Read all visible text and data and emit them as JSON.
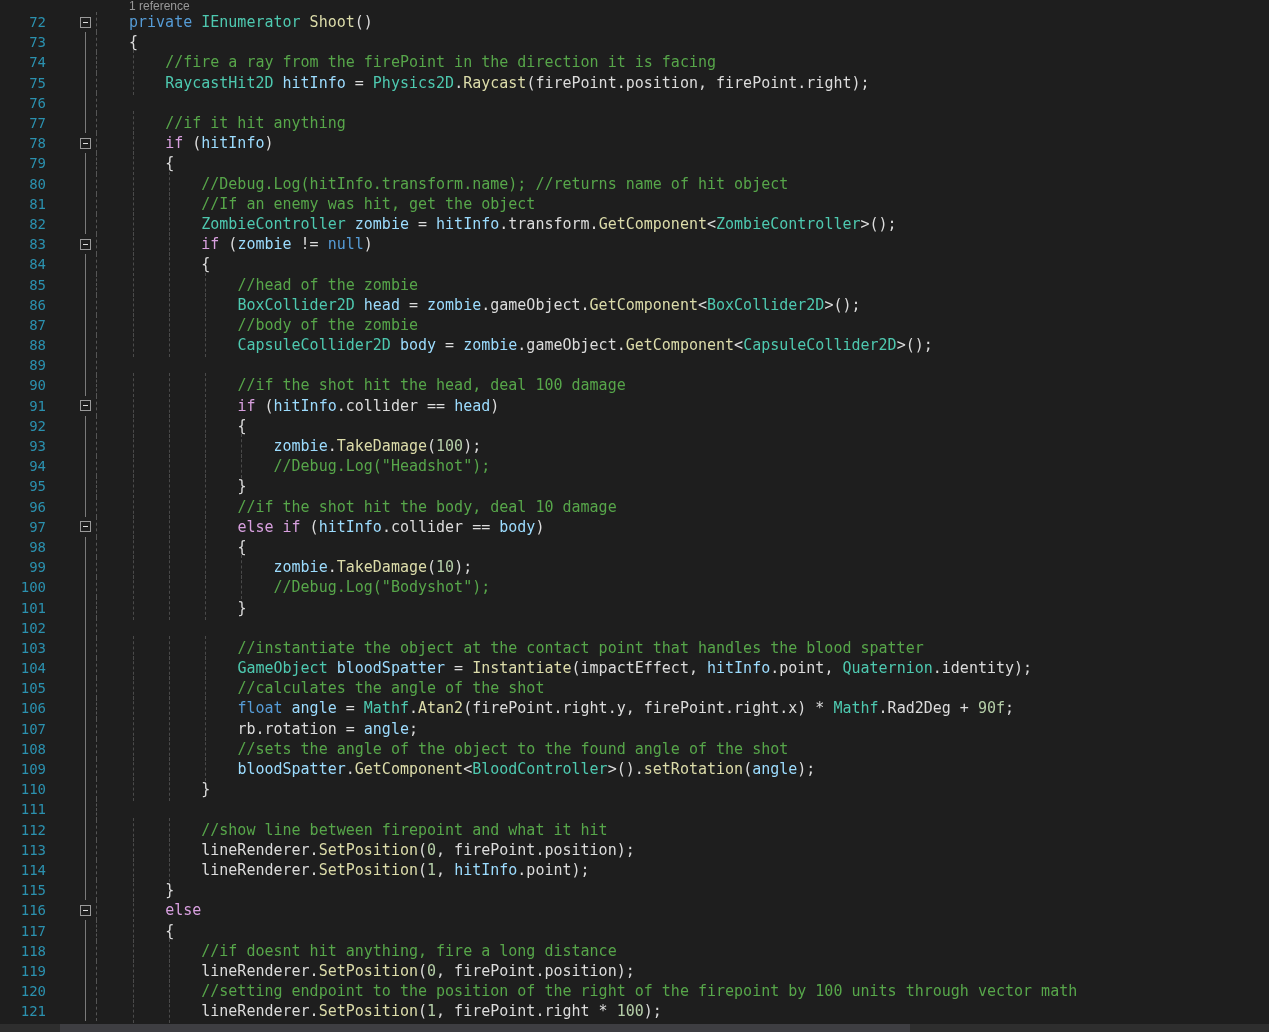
{
  "codelens": "1 reference",
  "lines": [
    {
      "number": "72",
      "foldable": true,
      "tokens": [
        {
          "kind": "keyword",
          "text": "private "
        },
        {
          "kind": "type",
          "text": "IEnumerator"
        },
        {
          "kind": "method",
          "text": " Shoot"
        },
        {
          "kind": "plain",
          "text": "()"
        }
      ]
    },
    {
      "number": "73",
      "foldable": false,
      "tokens": [
        {
          "kind": "plain",
          "text": "{"
        }
      ]
    },
    {
      "number": "74",
      "foldable": false,
      "tokens": [
        {
          "kind": "comment",
          "text": "    //fire a ray from the firePoint in the direction it is facing"
        }
      ]
    },
    {
      "number": "75",
      "foldable": false,
      "tokens": [
        {
          "kind": "type",
          "text": "    RaycastHit2D"
        },
        {
          "kind": "variable",
          "text": " hitInfo"
        },
        {
          "kind": "plain",
          "text": " = "
        },
        {
          "kind": "type",
          "text": "Physics2D"
        },
        {
          "kind": "plain",
          "text": "."
        },
        {
          "kind": "method",
          "text": "Raycast"
        },
        {
          "kind": "plain",
          "text": "(firePoint.position, firePoint.right);"
        }
      ]
    },
    {
      "number": "76",
      "foldable": false
    },
    {
      "number": "77",
      "foldable": false,
      "tokens": [
        {
          "kind": "comment",
          "text": "    //if it hit anything"
        }
      ]
    },
    {
      "number": "78",
      "foldable": true,
      "tokens": [
        {
          "kind": "control",
          "text": "    if"
        },
        {
          "kind": "plain",
          "text": " ("
        },
        {
          "kind": "variable",
          "text": "hitInfo"
        },
        {
          "kind": "plain",
          "text": ")"
        }
      ]
    },
    {
      "number": "79",
      "foldable": false,
      "tokens": [
        {
          "kind": "plain",
          "text": "    {"
        }
      ]
    },
    {
      "number": "80",
      "foldable": false,
      "tokens": [
        {
          "kind": "comment",
          "text": "        //Debug.Log(hitInfo.transform.name); //returns name of hit object"
        }
      ]
    },
    {
      "number": "81",
      "foldable": false,
      "tokens": [
        {
          "kind": "comment",
          "text": "        //If an enemy was hit, get the object"
        }
      ]
    },
    {
      "number": "82",
      "foldable": false,
      "tokens": [
        {
          "kind": "type",
          "text": "        ZombieController"
        },
        {
          "kind": "variable",
          "text": " zombie"
        },
        {
          "kind": "plain",
          "text": " = "
        },
        {
          "kind": "variable",
          "text": "hitInfo"
        },
        {
          "kind": "plain",
          "text": ".transform."
        },
        {
          "kind": "method",
          "text": "GetComponent"
        },
        {
          "kind": "plain",
          "text": "<"
        },
        {
          "kind": "type",
          "text": "ZombieController"
        },
        {
          "kind": "plain",
          "text": ">();"
        }
      ]
    },
    {
      "number": "83",
      "foldable": true,
      "tokens": [
        {
          "kind": "control",
          "text": "        if"
        },
        {
          "kind": "plain",
          "text": " ("
        },
        {
          "kind": "variable",
          "text": "zombie"
        },
        {
          "kind": "plain",
          "text": " != "
        },
        {
          "kind": "keyword",
          "text": "null"
        },
        {
          "kind": "plain",
          "text": ")"
        }
      ]
    },
    {
      "number": "84",
      "foldable": false,
      "tokens": [
        {
          "kind": "plain",
          "text": "        {"
        }
      ]
    },
    {
      "number": "85",
      "foldable": false,
      "tokens": [
        {
          "kind": "comment",
          "text": "            //head of the zombie"
        }
      ]
    },
    {
      "number": "86",
      "foldable": false,
      "tokens": [
        {
          "kind": "type",
          "text": "            BoxCollider2D"
        },
        {
          "kind": "variable",
          "text": " head"
        },
        {
          "kind": "plain",
          "text": " = "
        },
        {
          "kind": "variable",
          "text": "zombie"
        },
        {
          "kind": "plain",
          "text": ".gameObject."
        },
        {
          "kind": "method",
          "text": "GetComponent"
        },
        {
          "kind": "plain",
          "text": "<"
        },
        {
          "kind": "type",
          "text": "BoxCollider2D"
        },
        {
          "kind": "plain",
          "text": ">();"
        }
      ]
    },
    {
      "number": "87",
      "foldable": false,
      "tokens": [
        {
          "kind": "comment",
          "text": "            //body of the zombie"
        }
      ]
    },
    {
      "number": "88",
      "foldable": false,
      "tokens": [
        {
          "kind": "type",
          "text": "            CapsuleCollider2D"
        },
        {
          "kind": "variable",
          "text": " body"
        },
        {
          "kind": "plain",
          "text": " = "
        },
        {
          "kind": "variable",
          "text": "zombie"
        },
        {
          "kind": "plain",
          "text": ".gameObject."
        },
        {
          "kind": "method",
          "text": "GetComponent"
        },
        {
          "kind": "plain",
          "text": "<"
        },
        {
          "kind": "type",
          "text": "CapsuleCollider2D"
        },
        {
          "kind": "plain",
          "text": ">();"
        }
      ]
    },
    {
      "number": "89",
      "foldable": false
    },
    {
      "number": "90",
      "foldable": false,
      "tokens": [
        {
          "kind": "comment",
          "text": "            //if the shot hit the head, deal 100 damage"
        }
      ]
    },
    {
      "number": "91",
      "foldable": true,
      "tokens": [
        {
          "kind": "control",
          "text": "            if"
        },
        {
          "kind": "plain",
          "text": " ("
        },
        {
          "kind": "variable",
          "text": "hitInfo"
        },
        {
          "kind": "plain",
          "text": ".collider == "
        },
        {
          "kind": "variable",
          "text": "head"
        },
        {
          "kind": "plain",
          "text": ")"
        }
      ]
    },
    {
      "number": "92",
      "foldable": false,
      "tokens": [
        {
          "kind": "plain",
          "text": "            {"
        }
      ]
    },
    {
      "number": "93",
      "foldable": false,
      "tokens": [
        {
          "kind": "variable",
          "text": "                zombie"
        },
        {
          "kind": "plain",
          "text": "."
        },
        {
          "kind": "method",
          "text": "TakeDamage"
        },
        {
          "kind": "plain",
          "text": "("
        },
        {
          "kind": "number",
          "text": "100"
        },
        {
          "kind": "plain",
          "text": ");"
        }
      ]
    },
    {
      "number": "94",
      "foldable": false,
      "tokens": [
        {
          "kind": "comment",
          "text": "                //Debug.Log(\"Headshot\");"
        }
      ]
    },
    {
      "number": "95",
      "foldable": false,
      "tokens": [
        {
          "kind": "plain",
          "text": "            }"
        }
      ]
    },
    {
      "number": "96",
      "foldable": false,
      "tokens": [
        {
          "kind": "comment",
          "text": "            //if the shot hit the body, deal 10 damage"
        }
      ]
    },
    {
      "number": "97",
      "foldable": true,
      "tokens": [
        {
          "kind": "control",
          "text": "            else if"
        },
        {
          "kind": "plain",
          "text": " ("
        },
        {
          "kind": "variable",
          "text": "hitInfo"
        },
        {
          "kind": "plain",
          "text": ".collider == "
        },
        {
          "kind": "variable",
          "text": "body"
        },
        {
          "kind": "plain",
          "text": ")"
        }
      ]
    },
    {
      "number": "98",
      "foldable": false,
      "tokens": [
        {
          "kind": "plain",
          "text": "            {"
        }
      ]
    },
    {
      "number": "99",
      "foldable": false,
      "tokens": [
        {
          "kind": "variable",
          "text": "                zombie"
        },
        {
          "kind": "plain",
          "text": "."
        },
        {
          "kind": "method",
          "text": "TakeDamage"
        },
        {
          "kind": "plain",
          "text": "("
        },
        {
          "kind": "number",
          "text": "10"
        },
        {
          "kind": "plain",
          "text": ");"
        }
      ]
    },
    {
      "number": "100",
      "foldable": false,
      "tokens": [
        {
          "kind": "comment",
          "text": "                //Debug.Log(\"Bodyshot\");"
        }
      ]
    },
    {
      "number": "101",
      "foldable": false,
      "tokens": [
        {
          "kind": "plain",
          "text": "            }"
        }
      ]
    },
    {
      "number": "102",
      "foldable": false
    },
    {
      "number": "103",
      "foldable": false,
      "tokens": [
        {
          "kind": "comment",
          "text": "            //instantiate the object at the contact point that handles the blood spatter"
        }
      ]
    },
    {
      "number": "104",
      "foldable": false,
      "tokens": [
        {
          "kind": "type",
          "text": "            GameObject"
        },
        {
          "kind": "variable",
          "text": " bloodSpatter"
        },
        {
          "kind": "plain",
          "text": " = "
        },
        {
          "kind": "method",
          "text": "Instantiate"
        },
        {
          "kind": "plain",
          "text": "(impactEffect, "
        },
        {
          "kind": "variable",
          "text": "hitInfo"
        },
        {
          "kind": "plain",
          "text": ".point, "
        },
        {
          "kind": "type",
          "text": "Quaternion"
        },
        {
          "kind": "plain",
          "text": ".identity);"
        }
      ]
    },
    {
      "number": "105",
      "foldable": false,
      "tokens": [
        {
          "kind": "comment",
          "text": "            //calculates the angle of the shot"
        }
      ]
    },
    {
      "number": "106",
      "foldable": false,
      "tokens": [
        {
          "kind": "keyword",
          "text": "            float"
        },
        {
          "kind": "variable",
          "text": " angle"
        },
        {
          "kind": "plain",
          "text": " = "
        },
        {
          "kind": "type",
          "text": "Mathf"
        },
        {
          "kind": "plain",
          "text": "."
        },
        {
          "kind": "method",
          "text": "Atan2"
        },
        {
          "kind": "plain",
          "text": "(firePoint.right.y, firePoint.right.x) * "
        },
        {
          "kind": "type",
          "text": "Mathf"
        },
        {
          "kind": "plain",
          "text": ".Rad2Deg + "
        },
        {
          "kind": "number",
          "text": "90f"
        },
        {
          "kind": "plain",
          "text": ";"
        }
      ]
    },
    {
      "number": "107",
      "foldable": false,
      "tokens": [
        {
          "kind": "plain",
          "text": "            rb.rotation = "
        },
        {
          "kind": "variable",
          "text": "angle"
        },
        {
          "kind": "plain",
          "text": ";"
        }
      ]
    },
    {
      "number": "108",
      "foldable": false,
      "tokens": [
        {
          "kind": "comment",
          "text": "            //sets the angle of the object to the found angle of the shot"
        }
      ]
    },
    {
      "number": "109",
      "foldable": false,
      "tokens": [
        {
          "kind": "variable",
          "text": "            bloodSpatter"
        },
        {
          "kind": "plain",
          "text": "."
        },
        {
          "kind": "method",
          "text": "GetComponent"
        },
        {
          "kind": "plain",
          "text": "<"
        },
        {
          "kind": "type",
          "text": "BloodController"
        },
        {
          "kind": "plain",
          "text": ">()."
        },
        {
          "kind": "method",
          "text": "setRotation"
        },
        {
          "kind": "plain",
          "text": "("
        },
        {
          "kind": "variable",
          "text": "angle"
        },
        {
          "kind": "plain",
          "text": ");"
        }
      ]
    },
    {
      "number": "110",
      "foldable": false,
      "tokens": [
        {
          "kind": "plain",
          "text": "        }"
        }
      ]
    },
    {
      "number": "111",
      "foldable": false
    },
    {
      "number": "112",
      "foldable": false,
      "tokens": [
        {
          "kind": "comment",
          "text": "        //show line between firepoint and what it hit"
        }
      ]
    },
    {
      "number": "113",
      "foldable": false,
      "tokens": [
        {
          "kind": "plain",
          "text": "        lineRenderer."
        },
        {
          "kind": "method",
          "text": "SetPosition"
        },
        {
          "kind": "plain",
          "text": "("
        },
        {
          "kind": "number",
          "text": "0"
        },
        {
          "kind": "plain",
          "text": ", firePoint.position);"
        }
      ]
    },
    {
      "number": "114",
      "foldable": false,
      "tokens": [
        {
          "kind": "plain",
          "text": "        lineRenderer."
        },
        {
          "kind": "method",
          "text": "SetPosition"
        },
        {
          "kind": "plain",
          "text": "("
        },
        {
          "kind": "number",
          "text": "1"
        },
        {
          "kind": "plain",
          "text": ", "
        },
        {
          "kind": "variable",
          "text": "hitInfo"
        },
        {
          "kind": "plain",
          "text": ".point);"
        }
      ]
    },
    {
      "number": "115",
      "foldable": false,
      "tokens": [
        {
          "kind": "plain",
          "text": "    }"
        }
      ]
    },
    {
      "number": "116",
      "foldable": true,
      "tokens": [
        {
          "kind": "control",
          "text": "    else"
        }
      ]
    },
    {
      "number": "117",
      "foldable": false,
      "tokens": [
        {
          "kind": "plain",
          "text": "    {"
        }
      ]
    },
    {
      "number": "118",
      "foldable": false,
      "tokens": [
        {
          "kind": "comment",
          "text": "        //if doesnt hit anything, fire a long distance"
        }
      ]
    },
    {
      "number": "119",
      "foldable": false,
      "tokens": [
        {
          "kind": "plain",
          "text": "        lineRenderer."
        },
        {
          "kind": "method",
          "text": "SetPosition"
        },
        {
          "kind": "plain",
          "text": "("
        },
        {
          "kind": "number",
          "text": "0"
        },
        {
          "kind": "plain",
          "text": ", firePoint.position);"
        }
      ]
    },
    {
      "number": "120",
      "foldable": false,
      "tokens": [
        {
          "kind": "comment",
          "text": "        //setting endpoint to the position of the right of the firepoint by 100 units through vector math"
        }
      ]
    },
    {
      "number": "121",
      "foldable": false,
      "tokens": [
        {
          "kind": "plain",
          "text": "        lineRenderer."
        },
        {
          "kind": "method",
          "text": "SetPosition"
        },
        {
          "kind": "plain",
          "text": "("
        },
        {
          "kind": "number",
          "text": "1"
        },
        {
          "kind": "plain",
          "text": ", firePoint.right * "
        },
        {
          "kind": "number",
          "text": "100"
        },
        {
          "kind": "plain",
          "text": ");"
        }
      ]
    }
  ]
}
